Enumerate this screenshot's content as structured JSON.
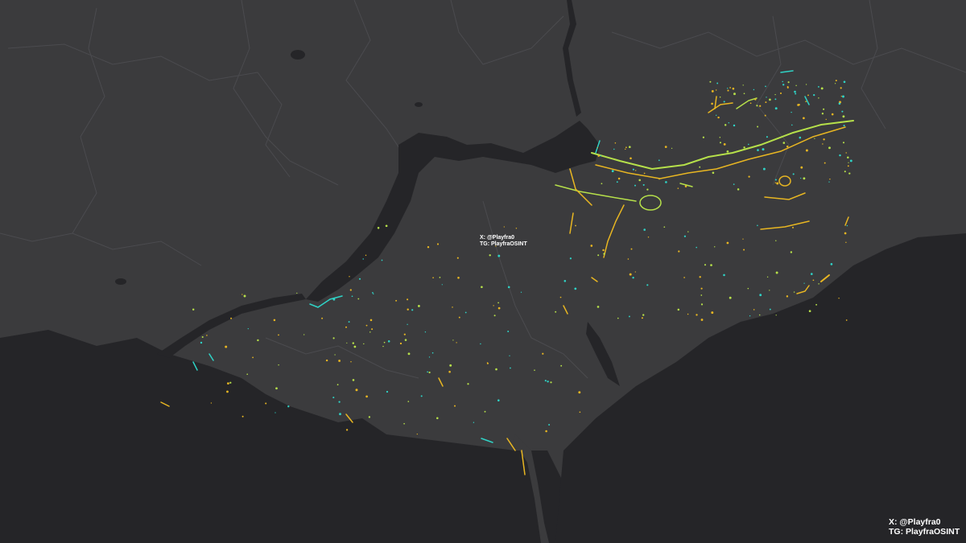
{
  "map": {
    "theme": "dark-gray-basemap",
    "colors": {
      "land": "#3b3b3d",
      "water": "#252528",
      "border": "#4d4d51",
      "trench_yellow": "#e8b622",
      "trench_light_green": "#b6e04a",
      "trench_cyan": "#2fd3c6"
    },
    "legend": "none"
  },
  "watermark_center": {
    "x_handle": "X: @Playfra0",
    "tg_handle": "TG: PlayfraOSINT"
  },
  "watermark_corner": {
    "x_handle": "X: @Playfra0",
    "tg_handle": "TG: PlayfraOSINT"
  }
}
